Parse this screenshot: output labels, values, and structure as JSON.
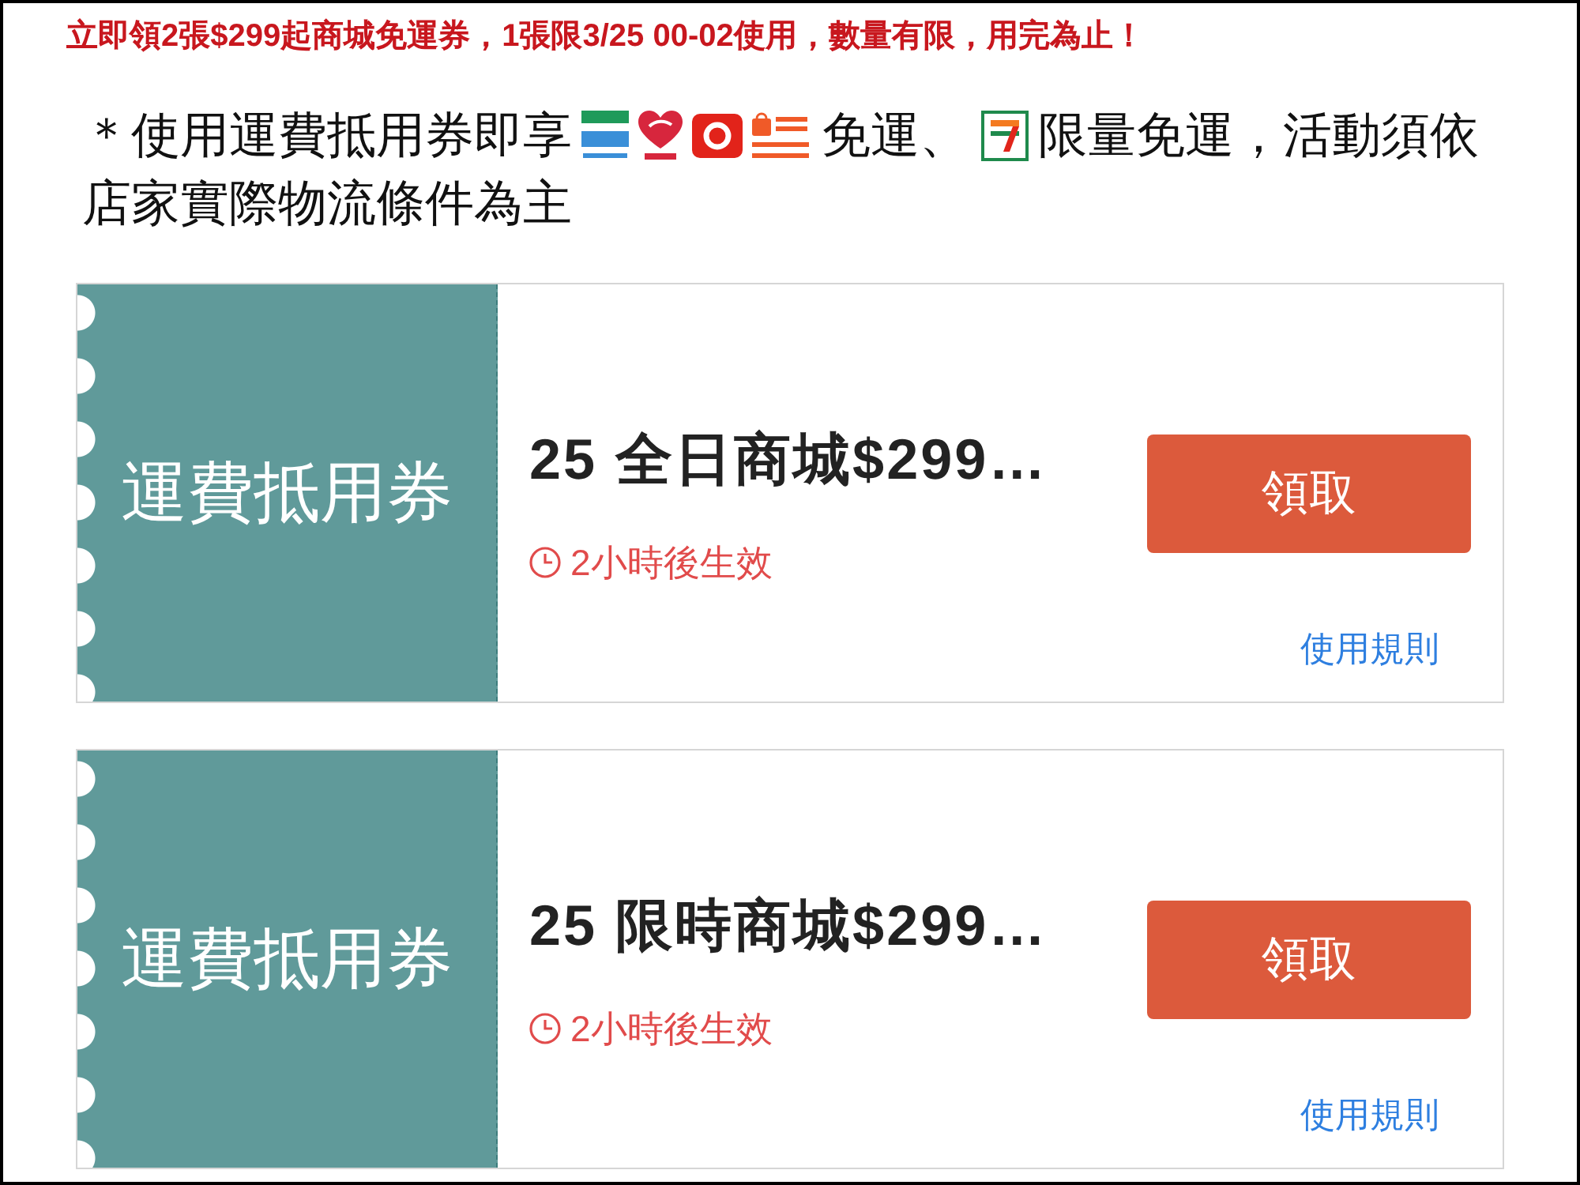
{
  "promo_banner": "立即領2張$299起商城免運券，1張限3/25 00-02使用，數量有限，用完為止！",
  "notice": {
    "lead": "＊使用運費抵用券即享",
    "middle": "免運、",
    "tail": "限量免運，活動須依",
    "line_2": "店家實際物流條件為主"
  },
  "coupons": [
    {
      "stub_label": "運費抵用券",
      "title": "25 全日商城$299…",
      "status": "2小時後生效",
      "claim_button": "領取",
      "rules_link": "使用規則"
    },
    {
      "stub_label": "運費抵用券",
      "title": "25 限時商城$299…",
      "status": "2小時後生效",
      "claim_button": "領取",
      "rules_link": "使用規則"
    }
  ]
}
